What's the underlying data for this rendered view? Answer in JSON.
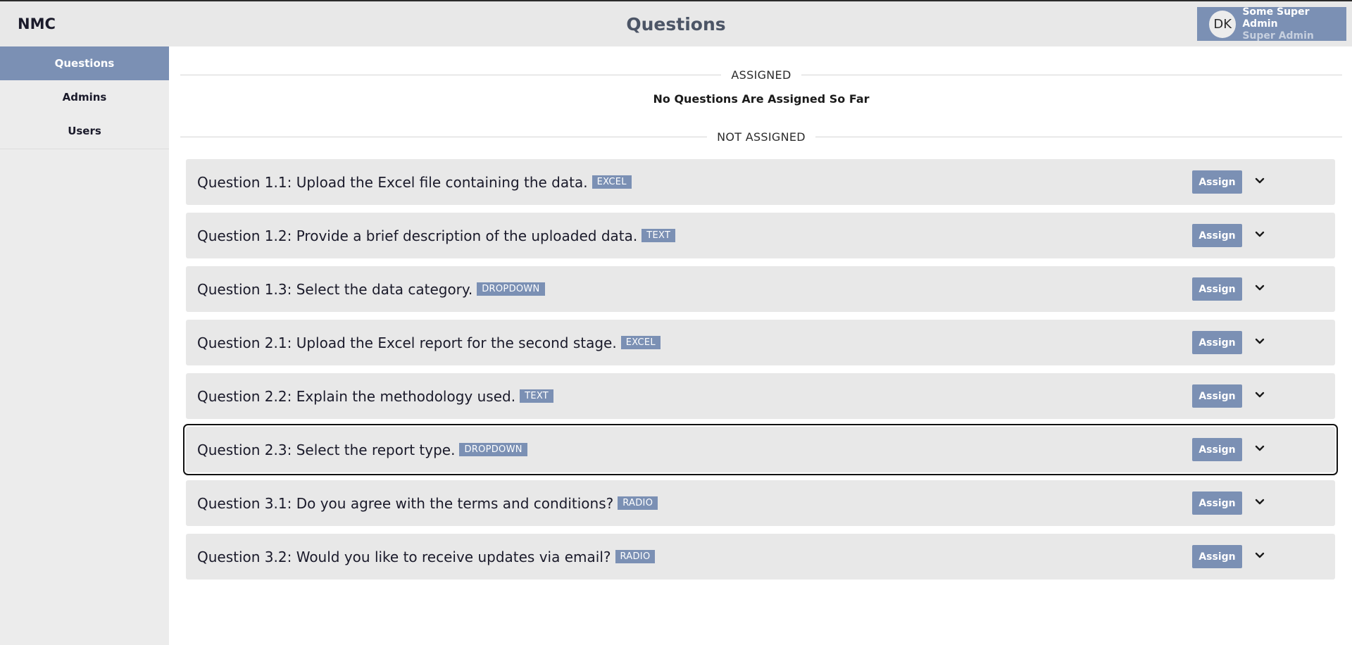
{
  "header": {
    "brand": "NMC",
    "title": "Questions",
    "user": {
      "initials": "DK",
      "name": "Some Super Admin",
      "role": "Super Admin"
    }
  },
  "sidebar": {
    "items": [
      {
        "label": "Questions",
        "active": true
      },
      {
        "label": "Admins",
        "active": false
      },
      {
        "label": "Users",
        "active": false
      }
    ]
  },
  "main": {
    "assigned": {
      "heading": "ASSIGNED",
      "empty_text": "No Questions Are Assigned So Far"
    },
    "not_assigned": {
      "heading": "NOT ASSIGNED",
      "assign_label": "Assign",
      "questions": [
        {
          "title": "Question 1.1: Upload the Excel file containing the data.",
          "tag": "EXCEL"
        },
        {
          "title": "Question 1.2: Provide a brief description of the uploaded data.",
          "tag": "TEXT"
        },
        {
          "title": "Question 1.3: Select the data category.",
          "tag": "DROPDOWN"
        },
        {
          "title": "Question 2.1: Upload the Excel report for the second stage.",
          "tag": "EXCEL"
        },
        {
          "title": "Question 2.2: Explain the methodology used.",
          "tag": "TEXT"
        },
        {
          "title": "Question 2.3: Select the report type.",
          "tag": "DROPDOWN"
        },
        {
          "title": "Question 3.1: Do you agree with the terms and conditions?",
          "tag": "RADIO"
        },
        {
          "title": "Question 3.2: Would you like to receive updates via email?",
          "tag": "RADIO"
        }
      ]
    }
  },
  "colors": {
    "accent": "#7b90b4",
    "card_bg": "#e8e8e8",
    "sidebar_bg": "#ececec"
  }
}
